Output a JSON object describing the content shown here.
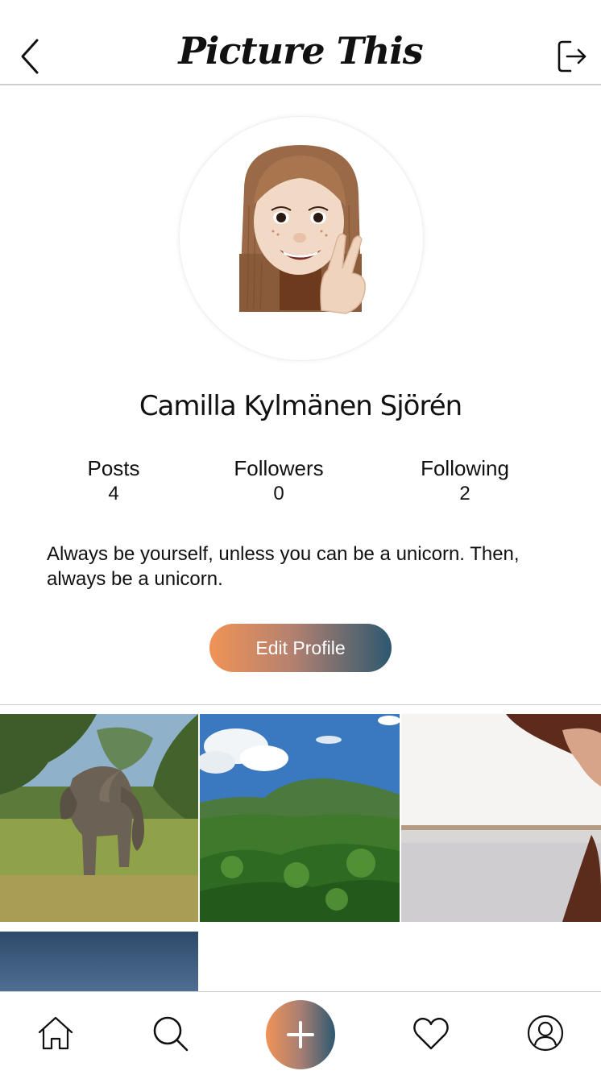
{
  "header": {
    "title": "Picture This",
    "back_icon": "chevron-left-icon",
    "logout_icon": "logout-icon"
  },
  "profile": {
    "name": "Camilla Kylmänen Sjörén",
    "bio": "Always be yourself, unless you can be a unicorn. Then, always be a unicorn.",
    "edit_label": "Edit Profile",
    "stats": [
      {
        "label": "Posts",
        "value": "4"
      },
      {
        "label": "Followers",
        "value": "0"
      },
      {
        "label": "Following",
        "value": "2"
      }
    ]
  },
  "colors": {
    "gradient_start": "#f09356",
    "gradient_end": "#2d5870",
    "divider": "#cfcfcf"
  },
  "grid": {
    "photos": [
      {
        "subject": "elephant"
      },
      {
        "subject": "mountain-jungle"
      },
      {
        "subject": "hat-lake"
      },
      {
        "subject": "sky-partial"
      }
    ]
  },
  "bottom_nav": {
    "items": [
      "home-icon",
      "search-icon",
      "add-icon",
      "heart-icon",
      "profile-icon"
    ]
  }
}
